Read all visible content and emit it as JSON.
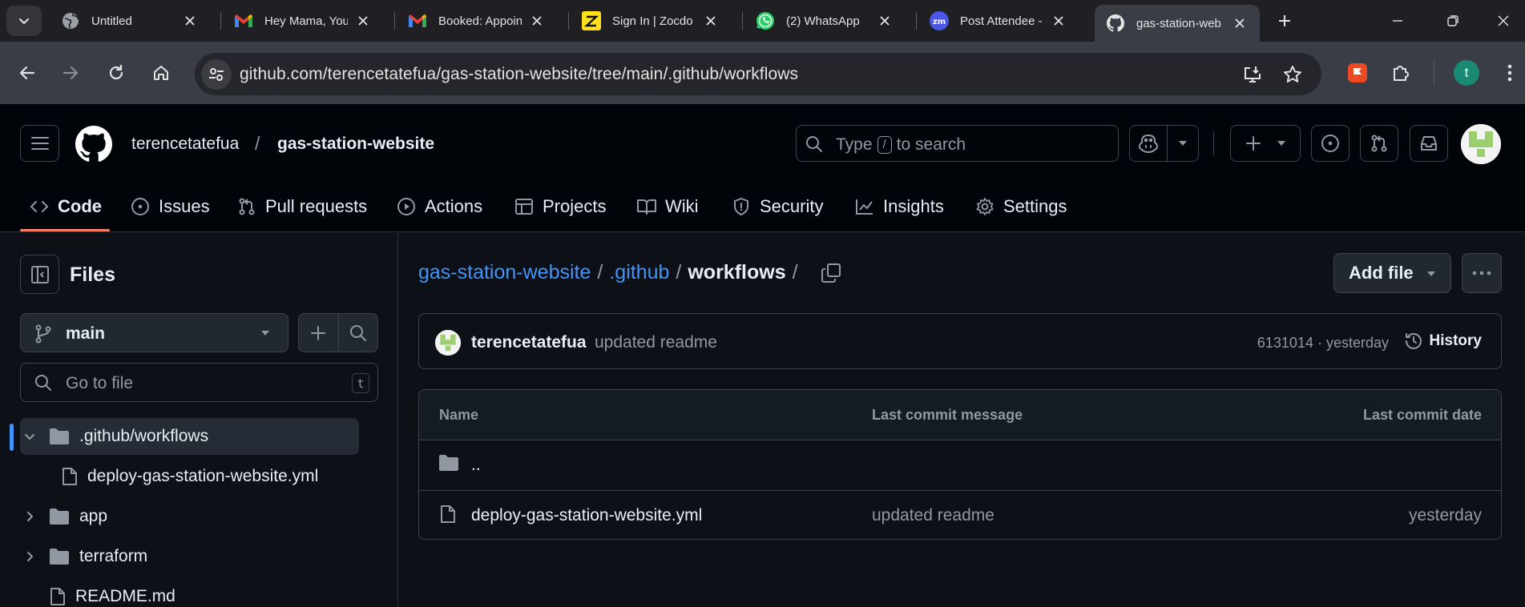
{
  "browser": {
    "tabs": [
      {
        "title": "Untitled",
        "icon": "globe-icon"
      },
      {
        "title": "Hey Mama, You",
        "icon": "gmail-icon"
      },
      {
        "title": "Booked: Appoin",
        "icon": "gmail-icon"
      },
      {
        "title": "Sign In | Zocdo",
        "icon": "zocdoc-icon"
      },
      {
        "title": "(2) WhatsApp",
        "icon": "whatsapp-icon"
      },
      {
        "title": "Post Attendee -",
        "icon": "zoom-icon"
      },
      {
        "title": "gas-station-web",
        "icon": "github-icon",
        "active": true
      }
    ],
    "url": "github.com/terencetatefua/gas-station-website/tree/main/.github/workflows",
    "profile_initial": "t",
    "colors": {
      "tabstrip": "#1f1f24",
      "toolbar": "#3b3d46",
      "omnibox": "#25262b",
      "profile": "#1a8a74"
    }
  },
  "github": {
    "owner": "terencetatefua",
    "separator": "/",
    "repo": "gas-station-website",
    "search": {
      "prefix": "Type",
      "key": "/",
      "suffix": "to search"
    },
    "nav": [
      {
        "label": "Code",
        "icon": "code-icon",
        "active": true
      },
      {
        "label": "Issues",
        "icon": "issue-icon"
      },
      {
        "label": "Pull requests",
        "icon": "pull-request-icon"
      },
      {
        "label": "Actions",
        "icon": "play-icon"
      },
      {
        "label": "Projects",
        "icon": "table-icon"
      },
      {
        "label": "Wiki",
        "icon": "book-icon"
      },
      {
        "label": "Security",
        "icon": "shield-icon"
      },
      {
        "label": "Insights",
        "icon": "graph-icon"
      },
      {
        "label": "Settings",
        "icon": "gear-icon"
      }
    ],
    "colors": {
      "accent": "#4493f8",
      "underline": "#f78166",
      "bg": "#0d1117",
      "header": "#010409",
      "border": "#3d444d"
    }
  },
  "sidebar": {
    "title": "Files",
    "branch": "main",
    "goto_placeholder": "Go to file",
    "goto_key": "t",
    "tree": [
      {
        "label": ".github/workflows",
        "type": "folder",
        "expanded": true,
        "selected": true
      },
      {
        "label": "deploy-gas-station-website.yml",
        "type": "file",
        "indent": 1
      },
      {
        "label": "app",
        "type": "folder",
        "expanded": false
      },
      {
        "label": "terraform",
        "type": "folder",
        "expanded": false
      },
      {
        "label": "README.md",
        "type": "file"
      }
    ]
  },
  "main": {
    "breadcrumb": {
      "root": "gas-station-website",
      "mid": ".github",
      "current": "workflows",
      "sep": "/"
    },
    "add_file": "Add file",
    "commit": {
      "author": "terencetatefua",
      "message": "updated readme",
      "sha": "6131014 · yesterday",
      "history": "History"
    },
    "table": {
      "headers": {
        "name": "Name",
        "message": "Last commit message",
        "date": "Last commit date"
      },
      "parent": "..",
      "rows": [
        {
          "name": "deploy-gas-station-website.yml",
          "message": "updated readme",
          "date": "yesterday",
          "icon": "file-icon"
        }
      ]
    }
  }
}
